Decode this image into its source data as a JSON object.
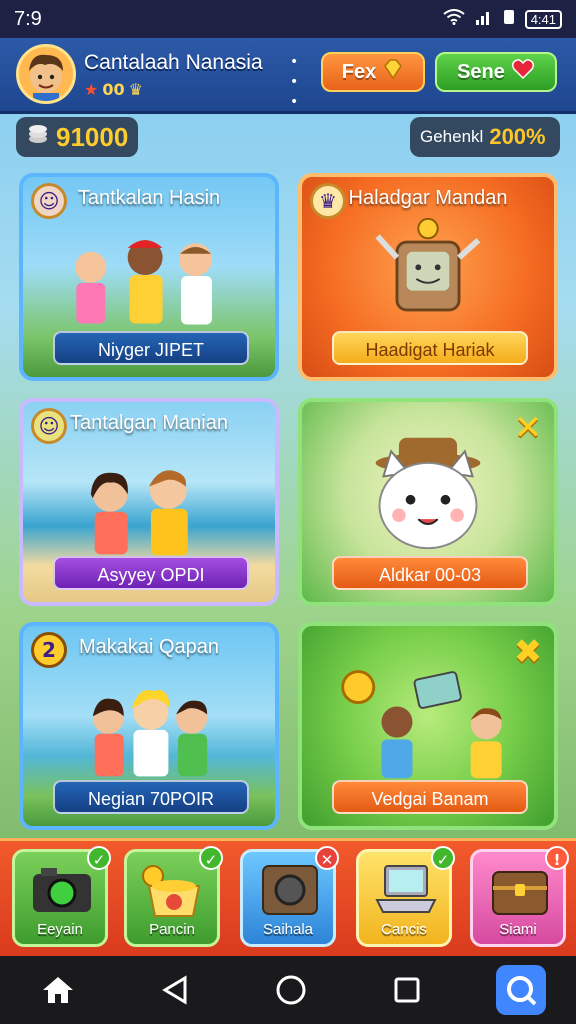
{
  "status": {
    "time": "7:9",
    "battery": "4:41"
  },
  "header": {
    "player_name": "Cantalaah Nanasia",
    "player_sub": "00",
    "btn_left": "Fex",
    "btn_right": "Sene"
  },
  "currency": {
    "amount": "91000"
  },
  "progress": {
    "label": "Gehenkl",
    "percent": "200%"
  },
  "cards": [
    {
      "title": "Tantkalan Hasin",
      "banner": "Niyger JIPET"
    },
    {
      "title": "Haladgar Mandan",
      "banner": "Haadigat Hariak"
    },
    {
      "title": "Tantalgan Manian",
      "banner": "Asyyey OPDI"
    },
    {
      "title": "",
      "banner": "Aldkar 00-03"
    },
    {
      "title": "Makakai Qapan",
      "badge": "2",
      "banner": "Negian 70POIR"
    },
    {
      "title": "",
      "banner": "Vedgai Banam"
    }
  ],
  "bottom_tiles": [
    {
      "label": "Eeyain"
    },
    {
      "label": "Pancin"
    },
    {
      "label": "Saihala"
    },
    {
      "label": "Cancis"
    },
    {
      "label": "Siami"
    }
  ],
  "colors": {
    "accent_orange": "#ff8a35",
    "accent_green": "#3fb62f",
    "header_blue": "#2c5aa8",
    "gold": "#ffc629"
  },
  "icons": {
    "nav": [
      "home-icon",
      "back-icon",
      "circle-home-icon",
      "recents-icon",
      "search-icon"
    ]
  }
}
